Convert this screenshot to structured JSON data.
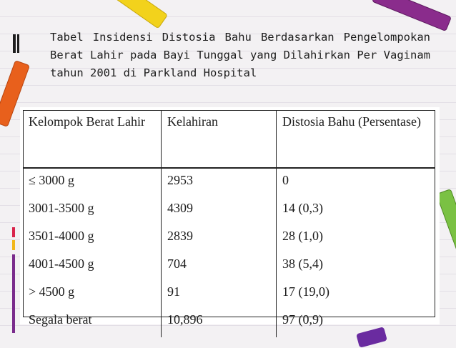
{
  "title": "Tabel    Insidensi  Distosia  Bahu  Berdasarkan Pengelompokan Berat Lahir pada Bayi Tunggal yang Dilahirkan  Per  Vaginam  tahun  2001  di  Parkland Hospital",
  "table": {
    "headers": [
      "Kelompok Berat Lahir",
      "Kelahiran",
      "Distosia Bahu (Persentase)"
    ],
    "rows": [
      [
        "≤ 3000 g",
        "2953",
        "0"
      ],
      [
        "3001-3500 g",
        "4309",
        "14 (0,3)"
      ],
      [
        "3501-4000 g",
        "2839",
        "28 (1,0)"
      ],
      [
        "4001-4500 g",
        "704",
        "38 (5,4)"
      ],
      [
        "> 4500 g",
        "91",
        "17 (19,0)"
      ],
      [
        "Segala berat",
        "10,896",
        "97 (0,9)"
      ]
    ]
  },
  "colors": {
    "background": "#f3f1f3",
    "crayon_yellow": "#f2d21c",
    "crayon_orange": "#e8601c",
    "crayon_purple": "#8a2c8c",
    "crayon_green": "#7ac143"
  }
}
